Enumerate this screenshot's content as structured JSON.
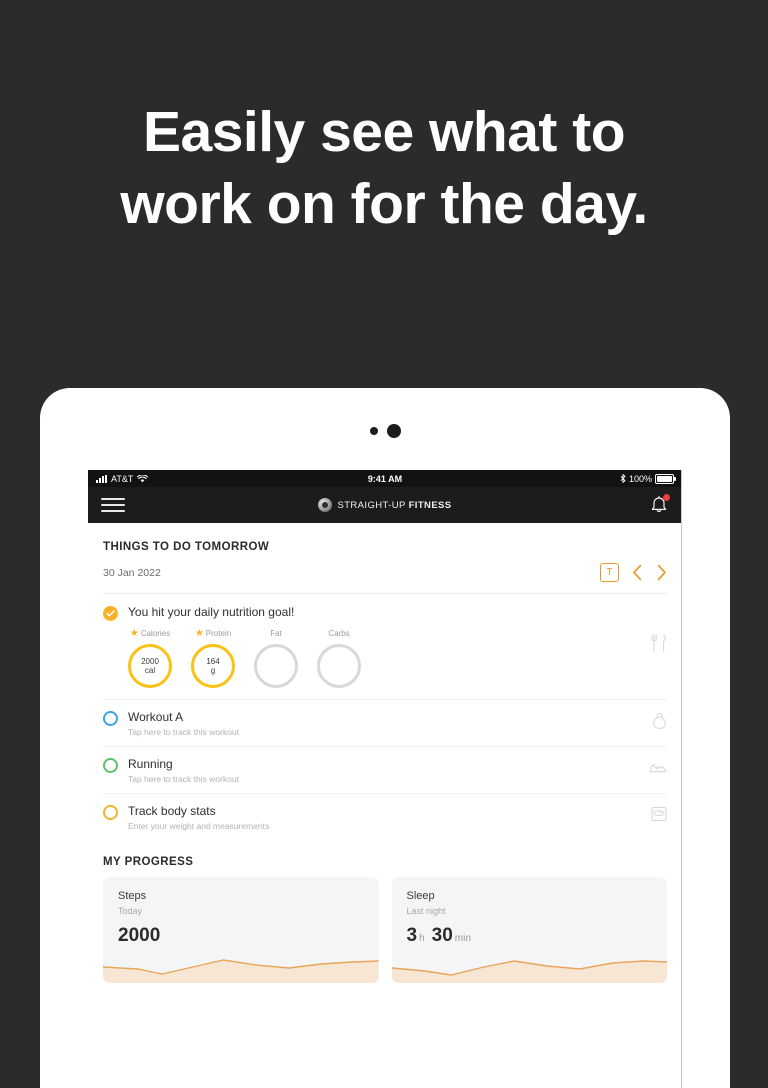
{
  "headline": {
    "line1": "Easily see what to",
    "line2": "work on for the day."
  },
  "device": {
    "camera_dots": 2
  },
  "statusbar": {
    "carrier": "AT&T",
    "signal_icon": "signal-bars-icon",
    "wifi_icon": "wifi-icon",
    "time": "9:41 AM",
    "bluetooth_icon": "bluetooth-icon",
    "battery_percent": "100%",
    "battery_icon": "battery-icon"
  },
  "navbar": {
    "menu_icon": "hamburger-menu-icon",
    "logo_icon": "brand-logo-icon",
    "brand_part1": "STRAIGHT-UP ",
    "brand_part2": "FITNESS",
    "bell_icon": "notification-bell-icon",
    "has_badge": true
  },
  "section": {
    "title": "THINGS TO DO TOMORROW",
    "date": "30 Jan 2022",
    "today_button": "T",
    "prev_icon": "chevron-left-icon",
    "next_icon": "chevron-right-icon"
  },
  "nutrition": {
    "check_icon": "check-circle-icon",
    "title": "You hit your daily nutrition goal!",
    "row_icon": "cutlery-icon",
    "macros": [
      {
        "name": "Calories",
        "starred": true,
        "value": "2000",
        "unit": "cal",
        "complete": true
      },
      {
        "name": "Protein",
        "starred": true,
        "value": "164",
        "unit": "g",
        "complete": true
      },
      {
        "name": "Fat",
        "starred": false,
        "value": "",
        "unit": "",
        "complete": false
      },
      {
        "name": "Carbs",
        "starred": false,
        "value": "",
        "unit": "",
        "complete": false
      }
    ]
  },
  "tasks": [
    {
      "title": "Workout A",
      "subtitle": "Tap here to track this workout",
      "color": "#3aa3e8",
      "icon": "kettlebell-icon"
    },
    {
      "title": "Running",
      "subtitle": "Tap here to track this workout",
      "color": "#5cc26a",
      "icon": "running-shoe-icon"
    },
    {
      "title": "Track body stats",
      "subtitle": "Enter your weight and measurements",
      "color": "#f0b429",
      "icon": "scale-icon"
    }
  ],
  "progress": {
    "title": "MY PROGRESS",
    "cards": [
      {
        "label": "Steps",
        "sublabel": "Today",
        "value": "2000",
        "unit": "",
        "value2": "",
        "unit2": ""
      },
      {
        "label": "Sleep",
        "sublabel": "Last night",
        "value": "3",
        "unit": "h",
        "value2": "30",
        "unit2": "min"
      }
    ]
  },
  "colors": {
    "background": "#2b2b2b",
    "accent_orange": "#e8992a",
    "accent_yellow": "#fac216",
    "card_bg": "#f4f5f7",
    "spark_line": "#e8a558"
  }
}
